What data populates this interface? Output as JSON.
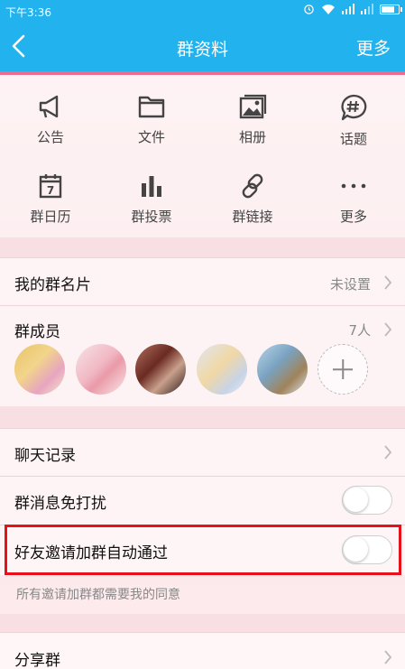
{
  "status_bar": {
    "time": "下午3:36",
    "icons": [
      "alarm-icon",
      "wifi-icon",
      "signal-icon",
      "signal-icon",
      "battery-icon"
    ],
    "battery_level": 0.7
  },
  "header": {
    "title": "群资料",
    "more_label": "更多",
    "back_icon": "back-icon"
  },
  "grid": [
    {
      "label": "公告",
      "icon": "megaphone-icon"
    },
    {
      "label": "文件",
      "icon": "folder-icon"
    },
    {
      "label": "相册",
      "icon": "photo-album-icon"
    },
    {
      "label": "话题",
      "icon": "hashtag-bubble-icon"
    },
    {
      "label": "群日历",
      "icon": "calendar-icon",
      "calendar_day": "7"
    },
    {
      "label": "群投票",
      "icon": "bar-chart-icon"
    },
    {
      "label": "群链接",
      "icon": "link-icon"
    },
    {
      "label": "更多",
      "icon": "more-dots-icon"
    }
  ],
  "rows": {
    "card": {
      "label": "我的群名片",
      "value": "未设置"
    },
    "members": {
      "label": "群成员",
      "value": "7人"
    },
    "chat_history": {
      "label": "聊天记录"
    },
    "mute": {
      "label": "群消息免打扰",
      "on": false
    },
    "auto_accept": {
      "label": "好友邀请加群自动通过",
      "on": false,
      "hint": "所有邀请加群都需要我的同意"
    },
    "share": {
      "label": "分享群"
    }
  },
  "colors": {
    "accent": "#22b2ee",
    "highlight": "#e6121b",
    "pink_line": "#f06a8e"
  }
}
